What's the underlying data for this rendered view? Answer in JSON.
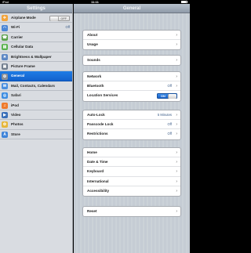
{
  "status_bar": {
    "device": "iPad",
    "time": "11:11"
  },
  "sidebar": {
    "title": "Settings",
    "items": [
      {
        "label": "Airplane Mode",
        "icon": "airplane-icon",
        "icon_color": "#f2a33a",
        "toggle": "OFF"
      },
      {
        "label": "Wi-Fi",
        "icon": "wifi-icon",
        "icon_color": "#4b86d6",
        "value": "Off"
      },
      {
        "label": "Carrier",
        "icon": "carrier-icon",
        "icon_color": "#5aa14a"
      },
      {
        "label": "Cellular Data",
        "icon": "cellular-icon",
        "icon_color": "#58b24d"
      },
      {
        "label": "Brightness & Wallpaper",
        "icon": "brightness-icon",
        "icon_color": "#5c87c4"
      },
      {
        "label": "Picture Frame",
        "icon": "picture-frame-icon",
        "icon_color": "#6f7c8c"
      },
      {
        "label": "General",
        "icon": "gear-icon",
        "icon_color": "#8a8f96",
        "selected": true
      },
      {
        "label": "Mail, Contacts, Calendars",
        "icon": "mail-icon",
        "icon_color": "#4a8fe0"
      },
      {
        "label": "Safari",
        "icon": "safari-icon",
        "icon_color": "#3d8de2"
      },
      {
        "label": "iPod",
        "icon": "ipod-icon",
        "icon_color": "#ef7a2b"
      },
      {
        "label": "Video",
        "icon": "video-icon",
        "icon_color": "#3a6fb8"
      },
      {
        "label": "Photos",
        "icon": "photos-icon",
        "icon_color": "#e6b63a"
      },
      {
        "label": "Store",
        "icon": "store-icon",
        "icon_color": "#3f84d9"
      }
    ]
  },
  "main": {
    "title": "General",
    "groups": [
      [
        {
          "label": "About"
        },
        {
          "label": "Usage"
        }
      ],
      [
        {
          "label": "Sounds"
        }
      ],
      [
        {
          "label": "Network"
        },
        {
          "label": "Bluetooth",
          "value": "Off"
        },
        {
          "label": "Location Services",
          "toggle": "ON"
        }
      ],
      [
        {
          "label": "Auto-Lock",
          "value": "5 Minutes"
        },
        {
          "label": "Passcode Lock",
          "value": "Off"
        },
        {
          "label": "Restrictions",
          "value": "Off"
        }
      ],
      [
        {
          "label": "Home"
        },
        {
          "label": "Date & Time"
        },
        {
          "label": "Keyboard"
        },
        {
          "label": "International"
        },
        {
          "label": "Accessibility"
        }
      ],
      [
        {
          "label": "Reset"
        }
      ]
    ]
  }
}
